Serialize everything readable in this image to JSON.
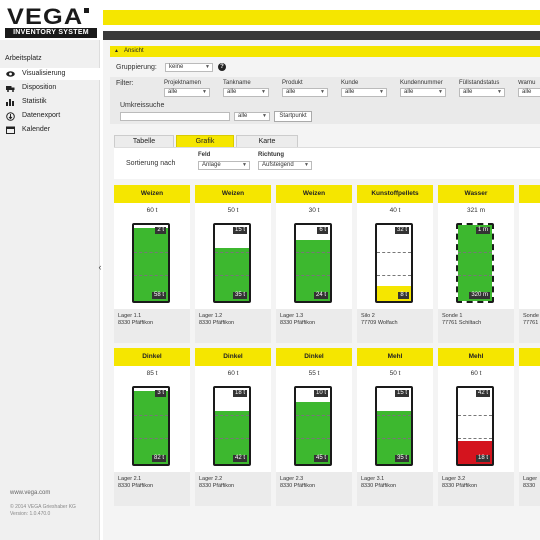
{
  "brand": {
    "name": "VEGA",
    "subtitle": "INVENTORY SYSTEM"
  },
  "sidebar": {
    "title": "Arbeitsplatz",
    "items": [
      {
        "label": "Visualisierung",
        "icon": "eye-icon",
        "active": true
      },
      {
        "label": "Disposition",
        "icon": "truck-icon",
        "active": false
      },
      {
        "label": "Statistik",
        "icon": "bar-chart-icon",
        "active": false
      },
      {
        "label": "Datenexport",
        "icon": "export-icon",
        "active": false
      },
      {
        "label": "Kalender",
        "icon": "calendar-icon",
        "active": false
      }
    ],
    "footer_url": "www.vega.com",
    "copyright": "© 2014 VEGA Grieshaber KG",
    "version": "Version: 1.0.470.0"
  },
  "view": {
    "title": "Ansicht",
    "grouping_label": "Gruppierung:",
    "grouping_value": "keine",
    "filter_label": "Filter:",
    "filters": [
      {
        "label": "Projektnamen",
        "value": "alle"
      },
      {
        "label": "Tankname",
        "value": "alle"
      },
      {
        "label": "Produkt",
        "value": "alle"
      },
      {
        "label": "Kunde",
        "value": "alle"
      },
      {
        "label": "Kundennummer",
        "value": "alle"
      },
      {
        "label": "Füllstandstatus",
        "value": "alle"
      },
      {
        "label": "Warnu",
        "value": "alle"
      }
    ],
    "radius_label": "Umkreissuche",
    "radius_value": "alle",
    "start_button": "Startpunkt"
  },
  "tabs": [
    {
      "label": "Tabelle",
      "active": false
    },
    {
      "label": "Grafik",
      "active": true
    },
    {
      "label": "Karte",
      "active": false
    }
  ],
  "sort": {
    "label": "Sortierung nach",
    "field_label": "Feld",
    "field_value": "Anlage",
    "direction_label": "Richtung",
    "direction_value": "Aufsteigend"
  },
  "colors": {
    "accent": "#f5e600",
    "green": "#3db82f",
    "yellow": "#f5e600",
    "red": "#d4141e"
  },
  "cards": [
    {
      "product": "Weizen",
      "capacity": "60 t",
      "free": "2 t",
      "fill": "58 t",
      "fill_ratio": 0.967,
      "color": "green",
      "tank": "Lager 1.1",
      "place": "8330 Pfäffikon"
    },
    {
      "product": "Weizen",
      "capacity": "50 t",
      "free": "15 t",
      "fill": "35 t",
      "fill_ratio": 0.7,
      "color": "green",
      "tank": "Lager 1.2",
      "place": "8330 Pfäffikon"
    },
    {
      "product": "Weizen",
      "capacity": "30 t",
      "free": "6 t",
      "fill": "24 t",
      "fill_ratio": 0.8,
      "color": "green",
      "tank": "Lager 1.3",
      "place": "8330 Pfäffikon"
    },
    {
      "product": "Kunstoffpellets",
      "capacity": "40 t",
      "free": "32 t",
      "fill": "8 t",
      "fill_ratio": 0.2,
      "color": "yellow",
      "tank": "Silo 2",
      "place": "77709 Wolfach"
    },
    {
      "product": "Wasser",
      "capacity": "321 m",
      "free": "1 m",
      "fill": "320 m",
      "fill_ratio": 0.997,
      "color": "green",
      "tank": "Sonde 1",
      "place": "77761 Schiltach",
      "dashed": true
    },
    {
      "product": "",
      "capacity": "",
      "free": "",
      "fill": "",
      "fill_ratio": 0.97,
      "color": "green",
      "tank": "Sonde",
      "place": "77761"
    },
    {
      "product": "Dinkel",
      "capacity": "85 t",
      "free": "3 t",
      "fill": "82 t",
      "fill_ratio": 0.965,
      "color": "green",
      "tank": "Lager 2.1",
      "place": "8330 Pfäffikon"
    },
    {
      "product": "Dinkel",
      "capacity": "60 t",
      "free": "18 t",
      "fill": "42 t",
      "fill_ratio": 0.7,
      "color": "green",
      "tank": "Lager 2.2",
      "place": "8330 Pfäffikon"
    },
    {
      "product": "Dinkel",
      "capacity": "55 t",
      "free": "10 t",
      "fill": "45 t",
      "fill_ratio": 0.818,
      "color": "green",
      "tank": "Lager 2.3",
      "place": "8330 Pfäffikon"
    },
    {
      "product": "Mehl",
      "capacity": "50 t",
      "free": "15 t",
      "fill": "35 t",
      "fill_ratio": 0.7,
      "color": "green",
      "tank": "Lager 3.1",
      "place": "8330 Pfäffikon"
    },
    {
      "product": "Mehl",
      "capacity": "60 t",
      "free": "42 t",
      "fill": "18 t",
      "fill_ratio": 0.3,
      "color": "red",
      "tank": "Lager 3.2",
      "place": "8330 Pfäffikon"
    },
    {
      "product": "",
      "capacity": "",
      "free": "",
      "fill": "",
      "fill_ratio": 0,
      "color": "green",
      "tank": "Lager",
      "place": "8330"
    }
  ]
}
